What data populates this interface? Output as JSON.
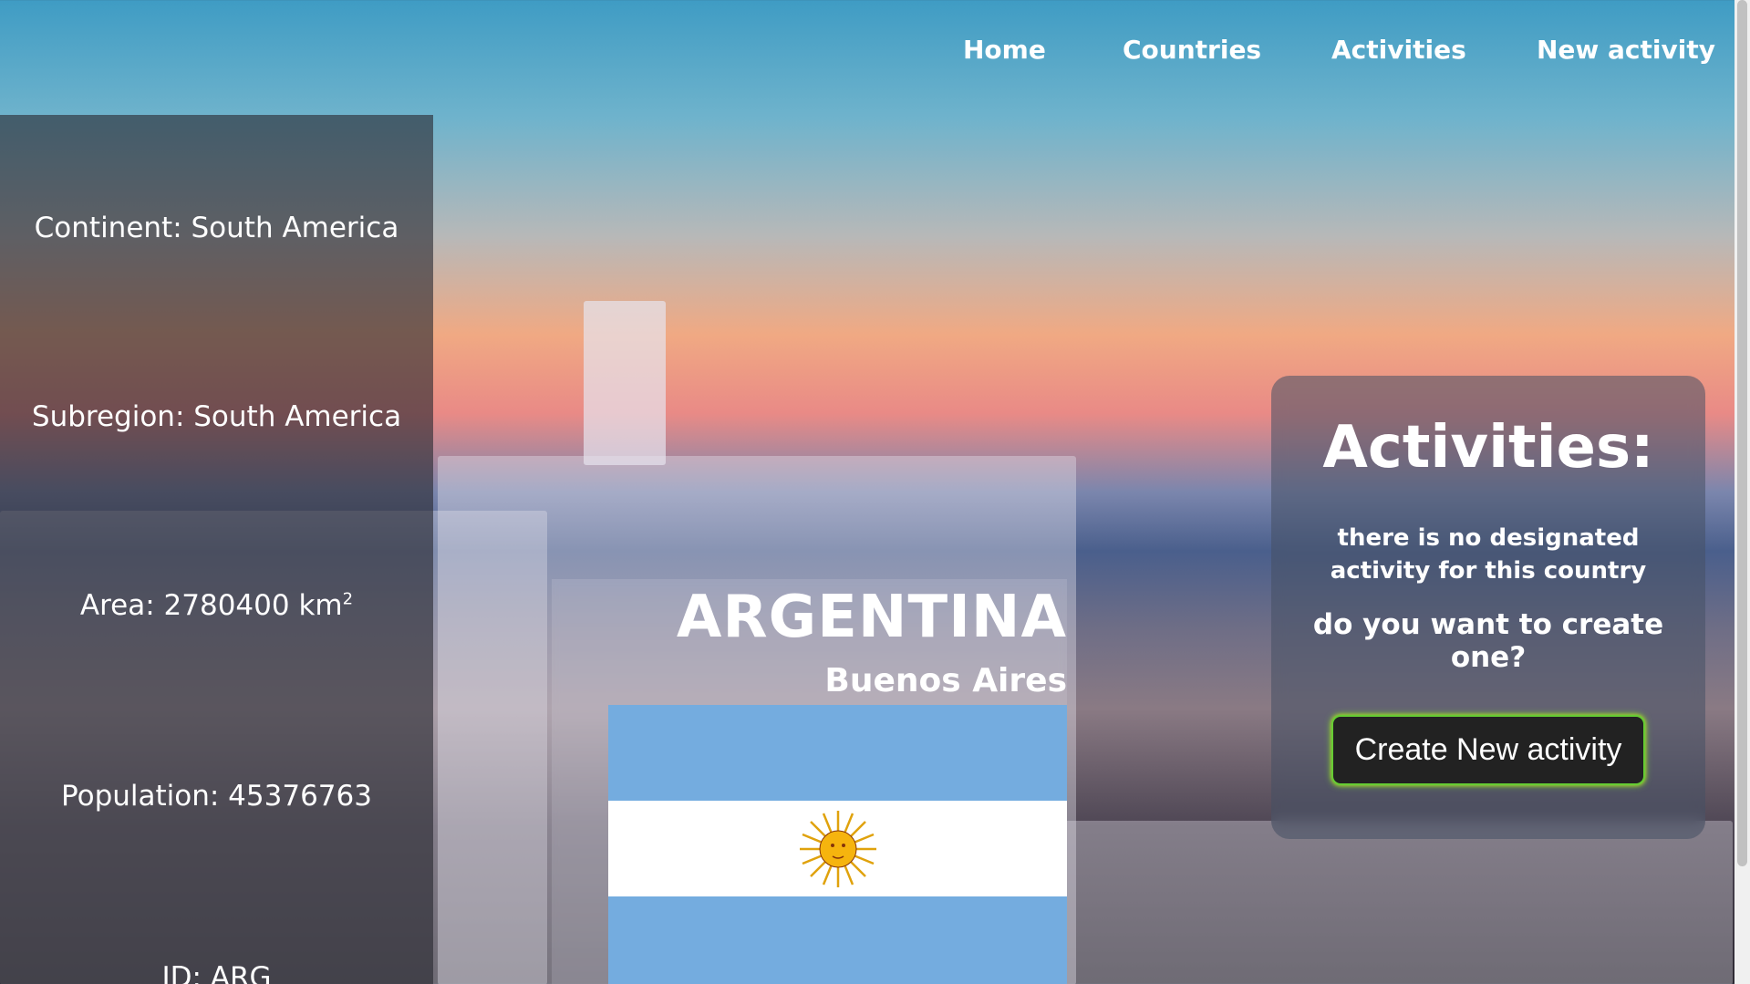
{
  "nav": {
    "items": [
      "Home",
      "Countries",
      "Activities",
      "New activity"
    ]
  },
  "country": {
    "name": "ARGENTINA",
    "capital": "Buenos Aires",
    "continent": "Continent: South America",
    "subregion": "Subregion: South America",
    "area": "Area: 2780400 km",
    "area_unit_sup": "2",
    "population": "Population: 45376763",
    "id": "ID: ARG"
  },
  "flag": {
    "colors": {
      "blue": "#74acdf",
      "white": "#ffffff",
      "sun": "#f6b40e"
    },
    "icon": "sun-of-may-icon"
  },
  "activities": {
    "title": "Activities:",
    "empty_message": "there is no designated activity for this country",
    "prompt": "do you want to create one?",
    "create_button": "Create New activity"
  }
}
